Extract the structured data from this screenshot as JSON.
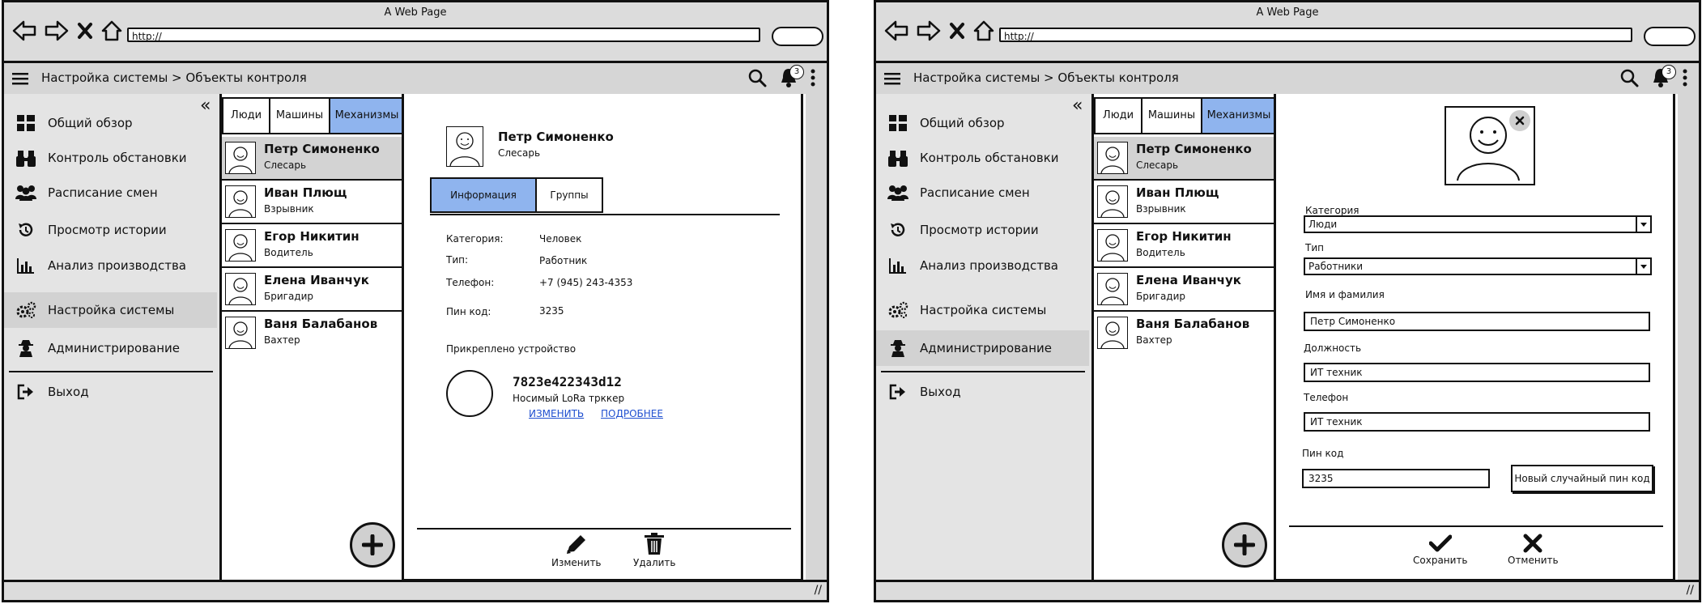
{
  "window": {
    "title": "A Web Page",
    "url": "http://"
  },
  "app": {
    "breadcrumb": "Настройка системы > Объекты контроля",
    "notifications_count": "3"
  },
  "sidebar": {
    "items": [
      {
        "label": "Общий обзор",
        "icon": "dashboard-icon"
      },
      {
        "label": "Контроль обстановки",
        "icon": "binoculars-icon"
      },
      {
        "label": "Расписание смен",
        "icon": "users-icon"
      },
      {
        "label": "Просмотр истории",
        "icon": "history-icon"
      },
      {
        "label": "Анализ производства",
        "icon": "bar-chart-icon"
      },
      {
        "label": "Настройка системы",
        "icon": "gears-icon"
      },
      {
        "label": "Администрирование",
        "icon": "user-secret-icon"
      },
      {
        "label": "Выход",
        "icon": "sign-out-icon"
      }
    ]
  },
  "tabs": [
    "Люди",
    "Машины",
    "Механизмы"
  ],
  "people": [
    {
      "name": "Петр Симоненко",
      "role": "Слесарь"
    },
    {
      "name": "Иван Плющ",
      "role": "Взрывник"
    },
    {
      "name": "Егор Никитин",
      "role": "Водитель"
    },
    {
      "name": "Елена Иванчук",
      "role": "Бригадир"
    },
    {
      "name": "Ваня Балабанов",
      "role": "Вахтер"
    }
  ],
  "detail": {
    "name": "Петр Симоненко",
    "role": "Слесарь",
    "tabs": [
      "Информация",
      "Группы"
    ],
    "fields": [
      {
        "key": "Категория:",
        "value": "Человек"
      },
      {
        "key": "Тип:",
        "value": "Работник"
      },
      {
        "key": "Телефон:",
        "value": "+7 (945) 243-4353"
      },
      {
        "key": "Пин код:",
        "value": "3235"
      }
    ],
    "device_header": "Прикреплено устройство",
    "device_id": "7823e422343d12",
    "device_type": "Носимый LoRa трккер",
    "link_change": "ИЗМЕНИТЬ",
    "link_more": "ПОДРОБНЕЕ",
    "edit_label": "Изменить",
    "delete_label": "Удалить"
  },
  "form": {
    "category_label": "Категория",
    "category_value": "Люди",
    "type_label": "Тип",
    "type_value": "Работники",
    "name_label": "Имя и фамилия",
    "name_value": "Петр Симоненко",
    "position_label": "Должность",
    "position_value": "ИТ техник",
    "phone_label": "Телефон",
    "phone_value": "ИТ техник",
    "pin_label": "Пин код",
    "pin_value": "3235",
    "random_pin_label": "Новый случайный пин код",
    "save_label": "Сохранить",
    "cancel_label": "Отменить"
  },
  "colors": {
    "selected_tab": "#8fb4ee",
    "chrome": "#dcdcdc",
    "sidebar": "#e4e4e4"
  }
}
